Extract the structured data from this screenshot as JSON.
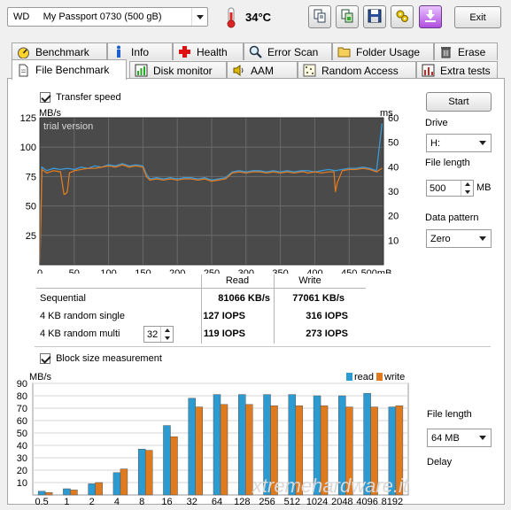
{
  "toolbar": {
    "drive_label": "WD     My Passport 0730 (500 gB)",
    "temperature": "34°C",
    "exit_label": "Exit"
  },
  "tabs_row1": [
    "Benchmark",
    "Info",
    "Health",
    "Error Scan",
    "Folder Usage",
    "Erase"
  ],
  "tabs_row2": [
    "File Benchmark",
    "Disk monitor",
    "AAM",
    "Random Access",
    "Extra tests"
  ],
  "transfer": {
    "checkbox_label": "Transfer speed",
    "chart_data": {
      "type": "line",
      "title": "",
      "xlabel": "",
      "ylabel_left": "MB/s",
      "ylabel_right": "ms",
      "watermark": "trial version",
      "x_ticks": [
        "0",
        "50",
        "100",
        "150",
        "200",
        "250",
        "300",
        "350",
        "400",
        "450",
        "500mB"
      ],
      "y_left_ticks": [
        "125",
        "100",
        "75",
        "50",
        "25"
      ],
      "y_right_ticks": [
        "60",
        "50",
        "40",
        "30",
        "20",
        "10"
      ],
      "xlim": [
        0,
        500
      ],
      "ylim_left": [
        0,
        125
      ],
      "ylim_right": [
        0,
        60
      ],
      "series": [
        {
          "color": "#3a9ad9",
          "x": [
            0,
            3,
            10,
            20,
            30,
            40,
            50,
            60,
            70,
            80,
            90,
            100,
            110,
            120,
            130,
            140,
            150,
            155,
            160,
            170,
            180,
            190,
            200,
            210,
            220,
            230,
            240,
            250,
            260,
            270,
            280,
            290,
            300,
            310,
            320,
            330,
            340,
            350,
            360,
            370,
            380,
            390,
            400,
            410,
            420,
            430,
            440,
            450,
            460,
            470,
            480,
            490,
            498
          ],
          "y": [
            0,
            83,
            80,
            82,
            81,
            82,
            81,
            83,
            82,
            84,
            83,
            85,
            84,
            86,
            84,
            85,
            84,
            77,
            73,
            74,
            73,
            74,
            73,
            74,
            74,
            73,
            74,
            72,
            73,
            74,
            79,
            80,
            79,
            80,
            80,
            79,
            80,
            79,
            80,
            79,
            80,
            80,
            79,
            80,
            81,
            80,
            81,
            82,
            82,
            83,
            82,
            80,
            120
          ]
        },
        {
          "color": "#e07a1f",
          "x": [
            0,
            3,
            10,
            20,
            30,
            35,
            37,
            40,
            43,
            50,
            60,
            70,
            80,
            90,
            100,
            110,
            120,
            130,
            140,
            150,
            155,
            160,
            170,
            180,
            190,
            200,
            210,
            220,
            230,
            240,
            250,
            260,
            270,
            280,
            290,
            300,
            310,
            320,
            330,
            340,
            350,
            360,
            370,
            380,
            385,
            390,
            400,
            410,
            420,
            428,
            430,
            433,
            440,
            450,
            460,
            470,
            480,
            490,
            498
          ],
          "y": [
            0,
            81,
            78,
            80,
            79,
            60,
            60,
            62,
            78,
            80,
            81,
            82,
            82,
            83,
            84,
            83,
            85,
            83,
            84,
            83,
            75,
            72,
            73,
            72,
            73,
            72,
            73,
            73,
            72,
            73,
            71,
            72,
            73,
            78,
            79,
            78,
            79,
            79,
            78,
            79,
            78,
            79,
            78,
            79,
            79,
            78,
            79,
            78,
            79,
            79,
            62,
            70,
            80,
            81,
            81,
            82,
            81,
            79,
            82
          ]
        }
      ]
    },
    "results": {
      "header_read": "Read",
      "header_write": "Write",
      "rows": [
        {
          "label": "Sequential",
          "read": "81066 KB/s",
          "write": "77061 KB/s"
        },
        {
          "label": "4 KB random single",
          "read": "127 IOPS",
          "write": "316 IOPS"
        },
        {
          "label": "4 KB random multi",
          "read": "119 IOPS",
          "write": "273 IOPS",
          "queue": "32"
        }
      ]
    }
  },
  "side": {
    "start_label": "Start",
    "drive_label": "Drive",
    "drive_value": "H:",
    "file_length_label": "File length",
    "file_length_value": "500",
    "file_length_unit": "MB",
    "pattern_label": "Data pattern",
    "pattern_value": "Zero"
  },
  "block": {
    "checkbox_label": "Block size measurement",
    "file_length_label": "File length",
    "file_length_value": "64 MB",
    "delay_label": "Delay",
    "chart_data": {
      "type": "bar",
      "title": "",
      "ylabel": "MB/s",
      "ylim": [
        0,
        90
      ],
      "y_ticks": [
        "90",
        "80",
        "70",
        "60",
        "50",
        "40",
        "30",
        "20",
        "10"
      ],
      "categories": [
        "0.5",
        "1",
        "2",
        "4",
        "8",
        "16",
        "32",
        "64",
        "128",
        "256",
        "512",
        "1024",
        "2048",
        "4096",
        "8192"
      ],
      "series": [
        {
          "name": "read",
          "color": "#2b9bd2",
          "values": [
            3,
            5,
            9,
            18,
            37,
            56,
            78,
            81,
            81,
            81,
            81,
            80,
            80,
            82,
            71
          ]
        },
        {
          "name": "write",
          "color": "#e07a1f",
          "values": [
            2,
            4,
            10,
            21,
            36,
            47,
            71,
            73,
            73,
            72,
            72,
            72,
            71,
            71,
            72
          ]
        }
      ],
      "legend_position": "top-right",
      "watermark": "xtremehardware.it"
    }
  }
}
